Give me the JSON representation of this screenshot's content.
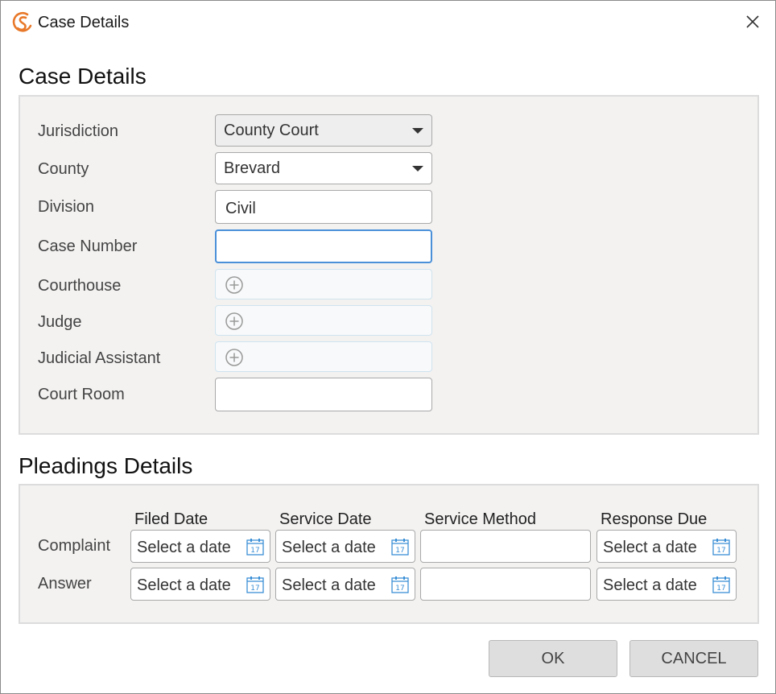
{
  "window": {
    "title": "Case Details",
    "logo_icon": "app-logo-icon",
    "close_icon": "close-icon",
    "accent": "#e8792a"
  },
  "case_details": {
    "heading": "Case Details",
    "fields": {
      "jurisdiction": {
        "label": "Jurisdiction",
        "value": "County Court"
      },
      "county": {
        "label": "County",
        "value": "Brevard"
      },
      "division": {
        "label": "Division",
        "value": "Civil"
      },
      "case_number": {
        "label": "Case Number",
        "value": ""
      },
      "courthouse": {
        "label": "Courthouse",
        "value": ""
      },
      "judge": {
        "label": "Judge",
        "value": ""
      },
      "judicial_assistant": {
        "label": "Judicial Assistant",
        "value": ""
      },
      "court_room": {
        "label": "Court Room",
        "value": ""
      }
    }
  },
  "pleadings": {
    "heading": "Pleadings Details",
    "columns": [
      "Filed Date",
      "Service Date",
      "Service Method",
      "Response Due"
    ],
    "rows": [
      {
        "label": "Complaint",
        "filed": "Select a date",
        "service": "Select a date",
        "method": "",
        "response": "Select a date"
      },
      {
        "label": "Answer",
        "filed": "Select a date",
        "service": "Select a date",
        "method": "",
        "response": "Select a date"
      }
    ]
  },
  "buttons": {
    "ok": "OK",
    "cancel": "CANCEL"
  },
  "colors": {
    "focus": "#4a90d9",
    "panel": "#f3f2f1",
    "calendar": "#3b8fd6"
  }
}
